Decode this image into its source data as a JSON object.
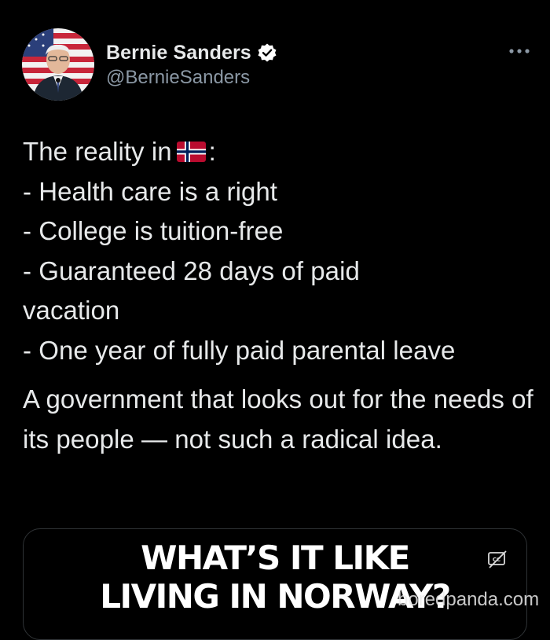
{
  "author": {
    "display_name": "Bernie Sanders",
    "handle": "@BernieSanders",
    "verified_icon": "verified-badge-icon",
    "avatar_icon": "profile-photo"
  },
  "menu": {
    "icon": "more-options-icon"
  },
  "tweet": {
    "line1_prefix": "The reality in",
    "line1_flag": "norway-flag-emoji",
    "line1_suffix": ":",
    "lines": [
      "- Health care is a right",
      "- College is tuition-free",
      "- Guaranteed 28 days of paid",
      "vacation",
      "- One year of fully paid parental leave"
    ],
    "paragraph2": "A government that looks out for the needs of its people — not such a radical idea."
  },
  "media_card": {
    "title_line1": "WHAT’S IT LIKE",
    "title_line2": "LIVING IN NORWAY?",
    "caption_icon": "closed-captions-icon"
  },
  "watermark": {
    "text": "boredpanda.com"
  },
  "colors": {
    "background": "#000000",
    "text_primary": "#e7e9ea",
    "text_secondary": "#8b98a5",
    "border": "#2f3336"
  }
}
